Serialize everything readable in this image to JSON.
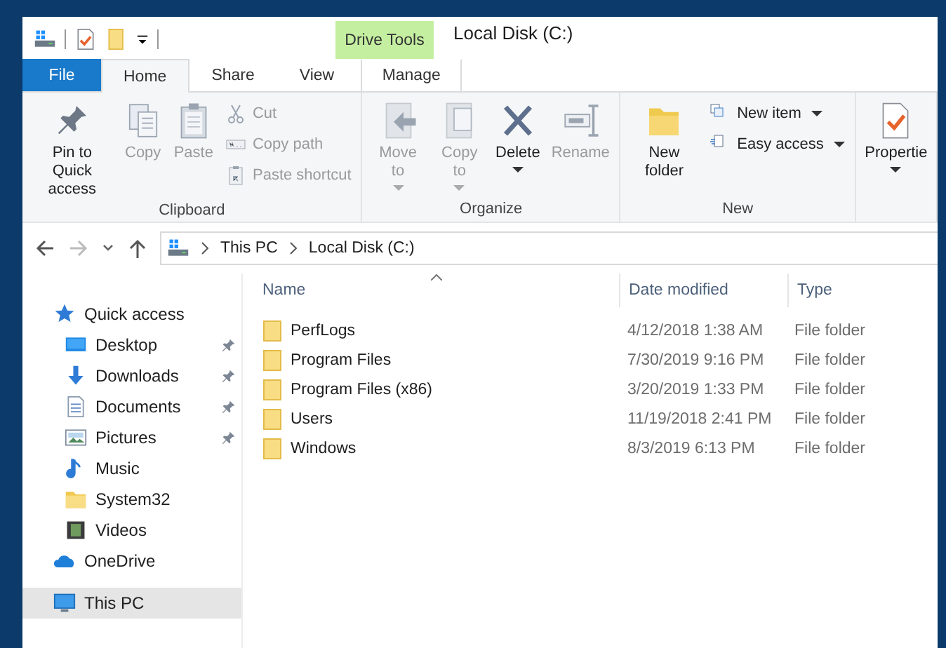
{
  "window": {
    "title": "Local Disk (C:)",
    "context_tab": "Drive Tools"
  },
  "tabs": [
    {
      "label": "File",
      "kind": "file",
      "selected": false
    },
    {
      "label": "Home",
      "kind": "plain",
      "selected": true
    },
    {
      "label": "Share",
      "kind": "plain",
      "selected": false
    },
    {
      "label": "View",
      "kind": "plain",
      "selected": false
    },
    {
      "label": "Manage",
      "kind": "context",
      "selected": false
    }
  ],
  "ribbon": {
    "groups": [
      {
        "label": "Clipboard",
        "items": [
          {
            "label": "Pin to Quick access",
            "kind": "pin",
            "disabled": false,
            "dropdown": false
          },
          {
            "label": "Copy",
            "kind": "copy",
            "disabled": true,
            "dropdown": false
          },
          {
            "label": "Paste",
            "kind": "paste",
            "disabled": true,
            "dropdown": false
          },
          {
            "stack": [
              {
                "label": "Cut",
                "kind": "cut",
                "disabled": true,
                "dropdown": false
              },
              {
                "label": "Copy path",
                "kind": "copypath",
                "disabled": true,
                "dropdown": false
              },
              {
                "label": "Paste shortcut",
                "kind": "pasteshortcut",
                "disabled": true,
                "dropdown": false
              }
            ]
          }
        ]
      },
      {
        "label": "Organize",
        "items": [
          {
            "label": "Move to",
            "kind": "moveto",
            "disabled": true,
            "dropdown": true
          },
          {
            "label": "Copy to",
            "kind": "copyto",
            "disabled": true,
            "dropdown": true
          },
          {
            "label": "Delete",
            "kind": "delete",
            "disabled": false,
            "dropdown": true
          },
          {
            "label": "Rename",
            "kind": "rename",
            "disabled": true,
            "dropdown": false
          }
        ]
      },
      {
        "label": "New",
        "items": [
          {
            "label": "New folder",
            "kind": "newfolder",
            "disabled": false,
            "dropdown": false
          },
          {
            "stack": [
              {
                "label": "New item",
                "kind": "newitem",
                "disabled": false,
                "dropdown": true
              },
              {
                "label": "Easy access",
                "kind": "easyaccess",
                "disabled": false,
                "dropdown": true
              }
            ]
          }
        ]
      },
      {
        "items": [
          {
            "label": "Propertie",
            "kind": "properties",
            "disabled": false,
            "dropdown": true
          }
        ]
      }
    ]
  },
  "navigation": {
    "back_disabled": false,
    "forward_disabled": true,
    "breadcrumbs": [
      "This PC",
      "Local Disk (C:)"
    ]
  },
  "sidebar": {
    "items": [
      {
        "label": "Quick access",
        "kind": "quick",
        "selected": false,
        "children": [
          {
            "label": "Desktop",
            "kind": "desktop",
            "pinned": true,
            "selected": false
          },
          {
            "label": "Downloads",
            "kind": "downloads",
            "pinned": true,
            "selected": false
          },
          {
            "label": "Documents",
            "kind": "documents",
            "pinned": true,
            "selected": false
          },
          {
            "label": "Pictures",
            "kind": "pictures",
            "pinned": true,
            "selected": false
          },
          {
            "label": "Music",
            "kind": "music",
            "pinned": false,
            "selected": false
          },
          {
            "label": "System32",
            "kind": "folder",
            "pinned": false,
            "selected": false
          },
          {
            "label": "Videos",
            "kind": "videos",
            "pinned": false,
            "selected": false
          }
        ]
      },
      {
        "label": "OneDrive",
        "kind": "onedrive",
        "selected": false
      },
      {
        "label": "This PC",
        "kind": "pc",
        "selected": true
      }
    ]
  },
  "table": {
    "columns": [
      {
        "label": "Name",
        "sorted": true
      },
      {
        "label": "Date modified",
        "sorted": false
      },
      {
        "label": "Type",
        "sorted": false
      }
    ],
    "rows": [
      {
        "name": "PerfLogs",
        "date": "4/12/2018 1:38 AM",
        "type": "File folder"
      },
      {
        "name": "Program Files",
        "date": "7/30/2019 9:16 PM",
        "type": "File folder"
      },
      {
        "name": "Program Files (x86)",
        "date": "3/20/2019 1:33 PM",
        "type": "File folder"
      },
      {
        "name": "Users",
        "date": "11/19/2018 2:41 PM",
        "type": "File folder"
      },
      {
        "name": "Windows",
        "date": "8/3/2019 6:13 PM",
        "type": "File folder"
      }
    ]
  }
}
